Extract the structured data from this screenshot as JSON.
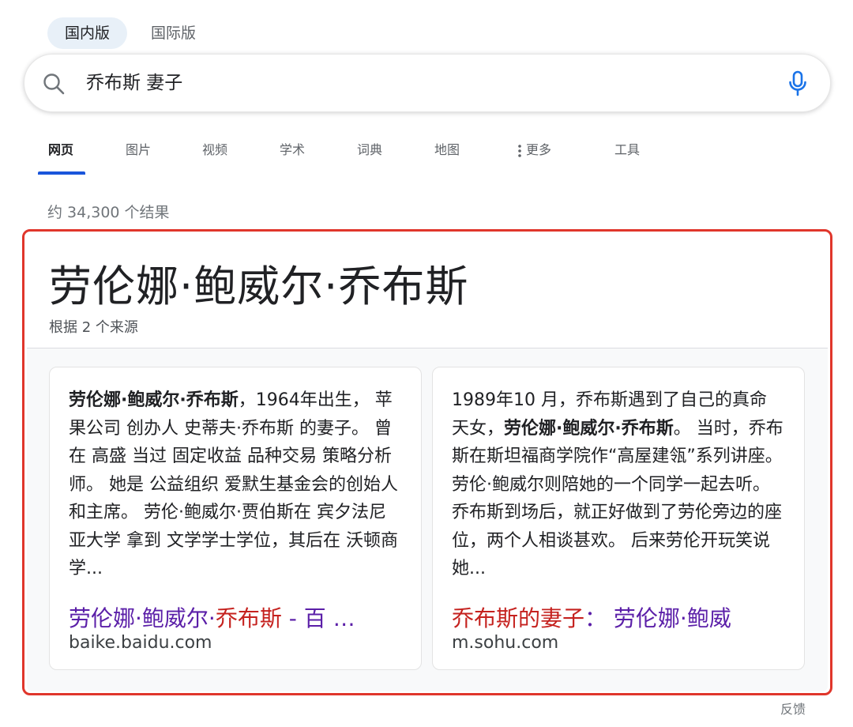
{
  "region_toggle": {
    "domestic": "国内版",
    "international": "国际版"
  },
  "search": {
    "query": "乔布斯 妻子"
  },
  "tabs": [
    {
      "label": "网页",
      "active": true
    },
    {
      "label": "图片"
    },
    {
      "label": "视频"
    },
    {
      "label": "学术"
    },
    {
      "label": "词典"
    },
    {
      "label": "地图"
    },
    {
      "label": "更多"
    },
    {
      "label": "工具"
    }
  ],
  "result_count": "约 34,300 个结果",
  "answer": {
    "title": "劳伦娜·鲍威尔·乔布斯",
    "subtitle": "根据 2 个来源",
    "cards": [
      {
        "body_bold": "劳伦娜·鲍威尔·乔布斯",
        "body_rest": "，1964年出生， 苹果公司 创办人 史蒂夫·乔布斯 的妻子。 曾在 高盛 当过 固定收益 品种交易 策略分析师。 她是 公益组织 爱默生基金会的创始人和主席。 劳伦·鲍威尔·贾伯斯在 宾夕法尼亚大学 拿到 文学学士学位，其后在 沃顿商学...",
        "link_part1": "劳伦娜·鲍威尔·",
        "link_part2": "乔布斯",
        "link_part3": " - 百 …",
        "domain": "baike.baidu.com"
      },
      {
        "body_pre": "1989年10 月，乔布斯遇到了自己的真命天女，",
        "body_bold": "劳伦娜·鲍威尔·乔布斯",
        "body_rest": "。 当时，乔布斯在斯坦福商学院作“高屋建瓴”系列讲座。 劳伦·鲍威尔则陪她的一个同学一起去听。 乔布斯到场后，就正好做到了劳伦旁边的座位，两个人相谈甚欢。 后来劳伦开玩笑说她...",
        "link_part1": "乔布斯的妻子",
        "link_part2": "：",
        "link_part3": " 劳伦娜·鲍威",
        "domain": "m.sohu.com"
      }
    ]
  },
  "feedback": "反馈",
  "colors": {
    "accent_blue": "#1a56db",
    "highlight_red": "#e0362b",
    "link_purple": "#5b1fa8",
    "link_red": "#c5221f"
  }
}
